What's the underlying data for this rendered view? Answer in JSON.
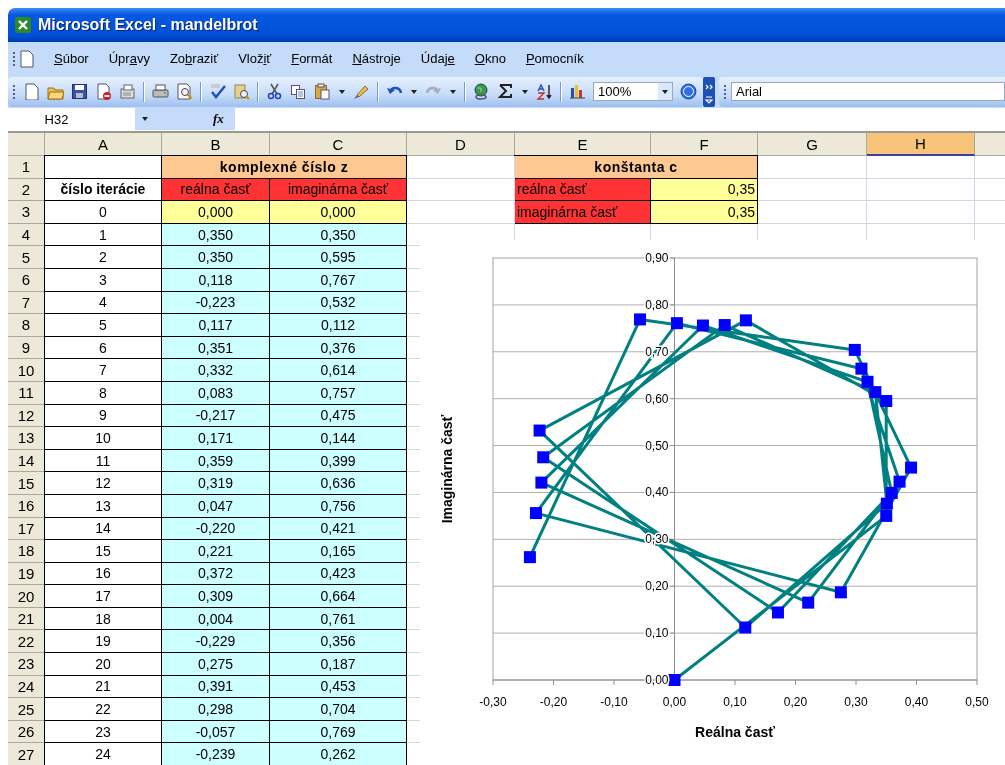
{
  "window": {
    "title": "Microsoft Excel - mandelbrot"
  },
  "menu": [
    {
      "key": "S",
      "after": "úbor"
    },
    {
      "before": "Úpr",
      "key": "a",
      "after": "vy"
    },
    {
      "before": "Zo",
      "key": "b",
      "after": "raziť"
    },
    {
      "before": "Vlož",
      "key": "i",
      "after": "ť"
    },
    {
      "key": "F",
      "after": "ormát"
    },
    {
      "key": "N",
      "after": "ástroje"
    },
    {
      "before": "Údaj",
      "key": "e"
    },
    {
      "key": "O",
      "after": "kno"
    },
    {
      "key": "P",
      "after": "omocník"
    }
  ],
  "toolbar": {
    "zoom": "100%",
    "font": "Arial"
  },
  "formula_bar": {
    "name_box": "H32",
    "function_label": "fx"
  },
  "sheet": {
    "columns": [
      {
        "label": "A",
        "selected": false
      },
      {
        "label": "B",
        "selected": false
      },
      {
        "label": "C",
        "selected": false
      },
      {
        "label": "D",
        "selected": false
      },
      {
        "label": "E",
        "selected": false
      },
      {
        "label": "F",
        "selected": false
      },
      {
        "label": "G",
        "selected": false
      },
      {
        "label": "H",
        "selected": true
      }
    ],
    "row_labels": [
      "1",
      "2",
      "3",
      "4",
      "5",
      "6",
      "7",
      "8",
      "9",
      "10",
      "11",
      "12",
      "13",
      "14",
      "15",
      "16",
      "17",
      "18",
      "19",
      "20",
      "21",
      "22",
      "23",
      "24",
      "25",
      "26",
      "27"
    ],
    "z_title": "komplexné číslo z",
    "iteration_header": "číslo iterácie",
    "re_header": "reálna časť",
    "im_header": "imaginárna časť",
    "c_title": "konštanta c",
    "constants": [
      {
        "label": "reálna časť",
        "value": "0,35"
      },
      {
        "label": "imaginárna časť",
        "value": "0,35"
      }
    ],
    "iterations": [
      {
        "n": "0",
        "re": "0,000",
        "im": "0,000",
        "kind": "input"
      },
      {
        "n": "1",
        "re": "0,350",
        "im": "0,350",
        "kind": "computed"
      },
      {
        "n": "2",
        "re": "0,350",
        "im": "0,595",
        "kind": "computed"
      },
      {
        "n": "3",
        "re": "0,118",
        "im": "0,767",
        "kind": "computed"
      },
      {
        "n": "4",
        "re": "-0,223",
        "im": "0,532",
        "kind": "computed"
      },
      {
        "n": "5",
        "re": "0,117",
        "im": "0,112",
        "kind": "computed"
      },
      {
        "n": "6",
        "re": "0,351",
        "im": "0,376",
        "kind": "computed"
      },
      {
        "n": "7",
        "re": "0,332",
        "im": "0,614",
        "kind": "computed"
      },
      {
        "n": "8",
        "re": "0,083",
        "im": "0,757",
        "kind": "computed"
      },
      {
        "n": "9",
        "re": "-0,217",
        "im": "0,475",
        "kind": "computed"
      },
      {
        "n": "10",
        "re": "0,171",
        "im": "0,144",
        "kind": "computed"
      },
      {
        "n": "11",
        "re": "0,359",
        "im": "0,399",
        "kind": "computed"
      },
      {
        "n": "12",
        "re": "0,319",
        "im": "0,636",
        "kind": "computed"
      },
      {
        "n": "13",
        "re": "0,047",
        "im": "0,756",
        "kind": "computed"
      },
      {
        "n": "14",
        "re": "-0,220",
        "im": "0,421",
        "kind": "computed"
      },
      {
        "n": "15",
        "re": "0,221",
        "im": "0,165",
        "kind": "computed"
      },
      {
        "n": "16",
        "re": "0,372",
        "im": "0,423",
        "kind": "computed"
      },
      {
        "n": "17",
        "re": "0,309",
        "im": "0,664",
        "kind": "computed"
      },
      {
        "n": "18",
        "re": "0,004",
        "im": "0,761",
        "kind": "computed"
      },
      {
        "n": "19",
        "re": "-0,229",
        "im": "0,356",
        "kind": "computed"
      },
      {
        "n": "20",
        "re": "0,275",
        "im": "0,187",
        "kind": "computed"
      },
      {
        "n": "21",
        "re": "0,391",
        "im": "0,453",
        "kind": "computed"
      },
      {
        "n": "22",
        "re": "0,298",
        "im": "0,704",
        "kind": "computed"
      },
      {
        "n": "23",
        "re": "-0,057",
        "im": "0,769",
        "kind": "computed"
      },
      {
        "n": "24",
        "re": "-0,239",
        "im": "0,262",
        "kind": "computed"
      }
    ],
    "chart": {
      "chart_data": {
        "type": "line",
        "grid": true,
        "xlabel": "Reálna časť",
        "ylabel": "Imaginárna časť",
        "x": [
          0,
          0.35,
          0.35,
          0.118,
          -0.223,
          0.117,
          0.351,
          0.332,
          0.083,
          -0.217,
          0.171,
          0.359,
          0.319,
          0.047,
          -0.22,
          0.221,
          0.372,
          0.309,
          0.004,
          -0.229,
          0.275,
          0.391,
          0.298,
          -0.057,
          -0.239
        ],
        "series": [
          {
            "color": "#008080",
            "marker": "square",
            "values": [
              0,
              0.35,
              0.595,
              0.767,
              0.532,
              0.112,
              0.376,
              0.614,
              0.757,
              0.475,
              0.144,
              0.399,
              0.636,
              0.756,
              0.421,
              0.165,
              0.423,
              0.664,
              0.761,
              0.356,
              0.187,
              0.453,
              0.704,
              0.769,
              0.262
            ]
          }
        ],
        "xlim": [
          -0.3,
          0.5
        ],
        "ylim": [
          0,
          0.9
        ],
        "xticks": [
          {
            "value": -0.3,
            "label": "-0,30"
          },
          {
            "value": -0.2,
            "label": "-0,20"
          },
          {
            "value": -0.1,
            "label": "-0,10"
          },
          {
            "value": 0,
            "label": "0,00"
          },
          {
            "value": 0.1,
            "label": "0,10"
          },
          {
            "value": 0.2,
            "label": "0,20"
          },
          {
            "value": 0.3,
            "label": "0,30"
          },
          {
            "value": 0.4,
            "label": "0,40"
          },
          {
            "value": 0.5,
            "label": "0,50"
          }
        ],
        "yticks": [
          {
            "value": 0,
            "label": "0,00"
          },
          {
            "value": 0.1,
            "label": "0,10"
          },
          {
            "value": 0.2,
            "label": "0,20"
          },
          {
            "value": 0.3,
            "label": "0,30"
          },
          {
            "value": 0.4,
            "label": "0,40"
          },
          {
            "value": 0.5,
            "label": "0,50"
          },
          {
            "value": 0.6,
            "label": "0,60"
          },
          {
            "value": 0.7,
            "label": "0,70"
          },
          {
            "value": 0.8,
            "label": "0,80"
          },
          {
            "value": 0.9,
            "label": "0,90"
          }
        ]
      }
    }
  }
}
